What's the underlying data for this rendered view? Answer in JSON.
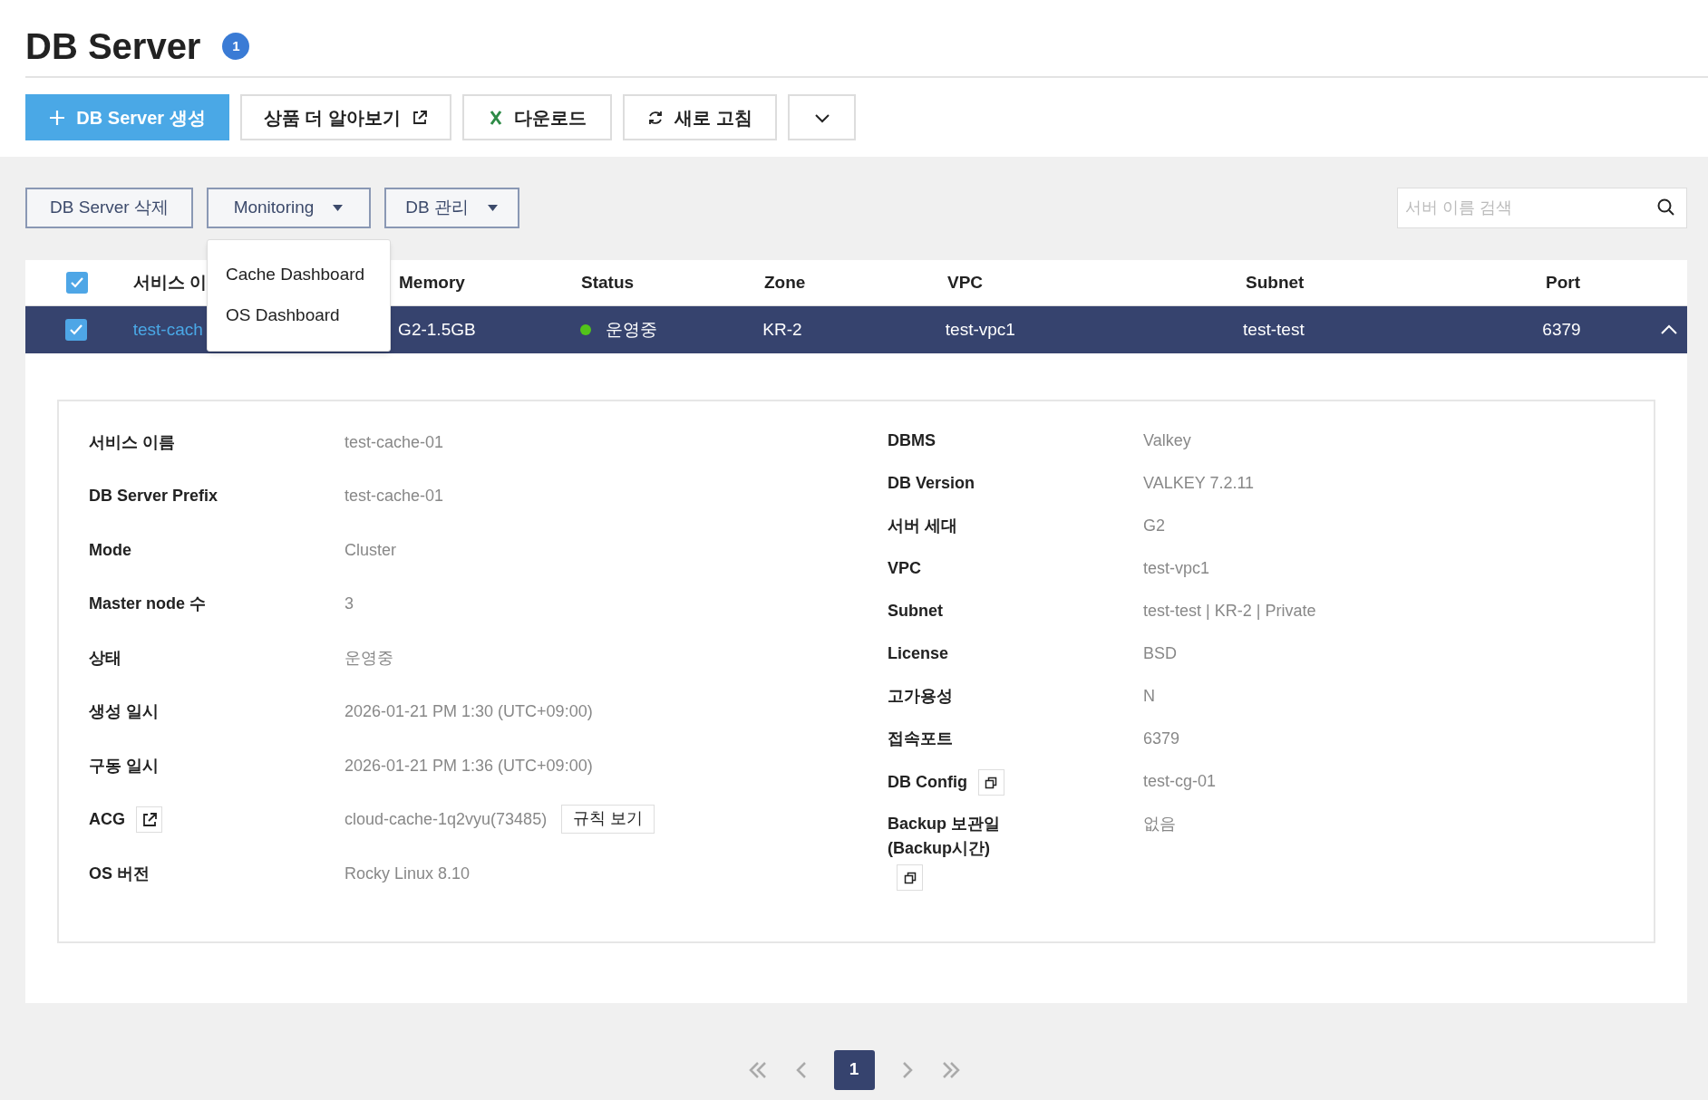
{
  "page": {
    "title": "DB Server",
    "count_badge": "1"
  },
  "toolbar": [
    {
      "kind": "create",
      "label": "DB Server 생성"
    },
    {
      "kind": "external",
      "label": "상품 더 알아보기"
    },
    {
      "kind": "download",
      "label": "다운로드"
    },
    {
      "kind": "refresh",
      "label": "새로 고침"
    },
    {
      "kind": "more"
    }
  ],
  "actions": [
    {
      "kind": "button",
      "label": "DB Server 삭제"
    },
    {
      "kind": "menu",
      "label": "Monitoring",
      "menu": [
        "Cache Dashboard",
        "OS Dashboard"
      ]
    },
    {
      "kind": "menu",
      "label": "DB 관리"
    }
  ],
  "search": {
    "placeholder": "서버 이름 검색"
  },
  "table": {
    "all_checked": true,
    "columns": [
      "서비스 이",
      "Memory",
      "Status",
      "Zone",
      "VPC",
      "Subnet",
      "Port"
    ],
    "rows": [
      {
        "checked": true,
        "selected": true,
        "expanded": true,
        "name": "test-cach",
        "memory": "G2-1.5GB",
        "status": {
          "label": "운영중",
          "color": "#52c41a"
        },
        "zone": "KR-2",
        "vpc": "test-vpc1",
        "subnet": "test-test",
        "port": "6379"
      }
    ]
  },
  "details": {
    "left": [
      {
        "label": "서비스 이름",
        "value": "test-cache-01"
      },
      {
        "label": "DB Server Prefix",
        "value": "test-cache-01"
      },
      {
        "label": "Mode",
        "value": "Cluster"
      },
      {
        "label": "Master node 수",
        "value": "3"
      },
      {
        "label": "상태",
        "value": "운영중"
      },
      {
        "label": "생성 일시",
        "value": "2026-01-21 PM 1:30 (UTC+09:00)"
      },
      {
        "label": "구동 일시",
        "value": "2026-01-21 PM 1:36 (UTC+09:00)"
      },
      {
        "label": "ACG",
        "open_link": true,
        "value": "cloud-cache-1q2vyu(73485)",
        "button": "규칙 보기"
      },
      {
        "label": "OS 버전",
        "value": "Rocky Linux 8.10"
      }
    ],
    "right": [
      {
        "label": "DBMS",
        "value": "Valkey"
      },
      {
        "label": "DB Version",
        "value": "VALKEY 7.2.11"
      },
      {
        "label": "서버 세대",
        "value": "G2"
      },
      {
        "label": "VPC",
        "value": "test-vpc1"
      },
      {
        "label": "Subnet",
        "value": "test-test | KR-2 | Private"
      },
      {
        "label": "License",
        "value": "BSD"
      },
      {
        "label": "고가용성",
        "value": "N"
      },
      {
        "label": "접속포트",
        "value": "6379"
      },
      {
        "label": "DB Config",
        "copyable": true,
        "value": "test-cg-01"
      },
      {
        "label": "Backup 보관일(Backup시간)",
        "copyable": true,
        "value": "없음"
      }
    ]
  },
  "pagination": {
    "pages": [
      {
        "label": "1",
        "selected": true
      }
    ]
  }
}
